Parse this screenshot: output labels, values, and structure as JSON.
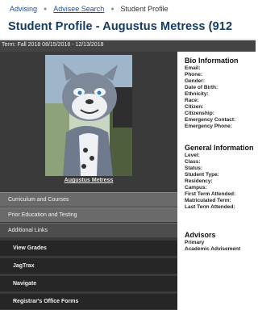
{
  "breadcrumb": {
    "items": [
      "Advising",
      "Advisee Search",
      "Student Profile"
    ]
  },
  "page_title": "Student Profile - Augustus Metress (912",
  "term": "Term: Fall 2018 08/15/2018 - 12/13/2018",
  "student": {
    "name_link": "Augustus Metress"
  },
  "sidebar": {
    "sections": [
      "Curriculum and Courses",
      "Prior Education and Testing",
      "Additional Links"
    ],
    "links": [
      "View Grades",
      "JagTrax",
      "Navigate",
      "Registrar's Office Forms"
    ]
  },
  "bio": {
    "title": "Bio Information",
    "fields": [
      "Email:",
      "Phone:",
      "Gender:",
      "Date of Birth:",
      "Ethnicity:",
      "Race:",
      "Citizen:",
      "Citizenship:",
      "Emergency Contact:",
      "Emergency Phone:"
    ]
  },
  "general": {
    "title": "General Information",
    "fields": [
      "Level:",
      "Class:",
      "Status:",
      "Student Type:",
      "Residency:",
      "Campus:",
      "First Term Attended:",
      "Matriculated Term:",
      "Last Term Attended:"
    ]
  },
  "advisors": {
    "title": "Advisors",
    "fields": [
      "Primary",
      "Academic Advisement"
    ]
  },
  "colors": {
    "title": "#123b63",
    "sidebar": "#3a3a3a",
    "link_bar": "#262626"
  }
}
